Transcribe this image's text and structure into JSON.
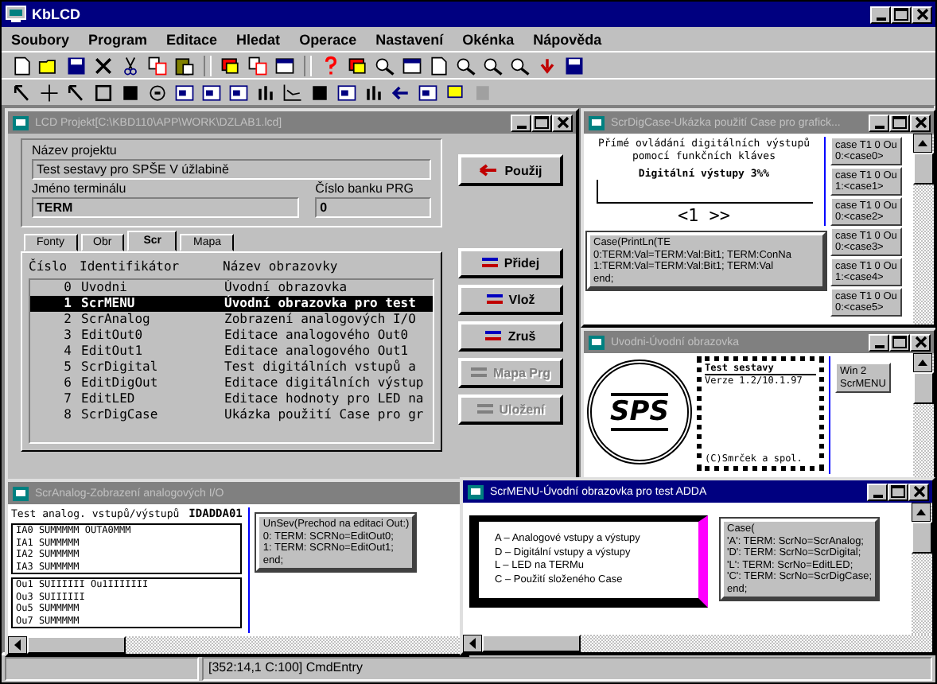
{
  "app": {
    "title": "KbLCD"
  },
  "menu": [
    "Soubory",
    "Program",
    "Editace",
    "Hledat",
    "Operace",
    "Nastavení",
    "Okénka",
    "Nápověda"
  ],
  "project": {
    "title": "LCD Projekt[C:\\KBD110\\APP\\WORK\\DZLAB1.lcd]",
    "active": false,
    "name_label": "Název projektu",
    "name_value": "Test sestavy pro SPŠE V úžlabině",
    "terminal_label": "Jméno terminálu",
    "terminal_value": "TERM",
    "bank_label": "Číslo banku PRG",
    "bank_value": "0",
    "apply_button": "Použij",
    "tabs": [
      {
        "label": "Fonty",
        "selected": false
      },
      {
        "label": "Obr",
        "selected": false
      },
      {
        "label": "Scr",
        "selected": true
      },
      {
        "label": "Mapa",
        "selected": false
      }
    ],
    "columns": [
      "Číslo",
      "Identifikátor",
      "Název obrazovky"
    ],
    "rows": [
      {
        "number": "0",
        "id": "Uvodni",
        "title": "Úvodní obrazovka",
        "selected": false
      },
      {
        "number": "1",
        "id": "ScrMENU",
        "title": "Úvodní obrazovka pro test",
        "selected": true
      },
      {
        "number": "2",
        "id": "ScrAnalog",
        "title": "Zobrazení analogových I/O",
        "selected": false
      },
      {
        "number": "3",
        "id": "EditOut0",
        "title": "Editace analogového Out0",
        "selected": false
      },
      {
        "number": "4",
        "id": "EditOut1",
        "title": "Editace analogového Out1",
        "selected": false
      },
      {
        "number": "5",
        "id": "ScrDigital",
        "title": "Test digitálních vstupů a",
        "selected": false
      },
      {
        "number": "6",
        "id": "EditDigOut",
        "title": "Editace digitálních výstup",
        "selected": false
      },
      {
        "number": "7",
        "id": "EditLED",
        "title": "Editace hodnoty pro LED na",
        "selected": false
      },
      {
        "number": "8",
        "id": "ScrDigCase",
        "title": "Ukázka použití Case pro gr",
        "selected": false
      }
    ],
    "buttons": [
      {
        "label": "Přidej",
        "disabled": false
      },
      {
        "label": "Vlož",
        "disabled": false
      },
      {
        "label": "Zruš",
        "disabled": false
      },
      {
        "label": "Mapa Prg",
        "disabled": true
      },
      {
        "label": "Uložení",
        "disabled": true
      }
    ]
  },
  "digcase": {
    "title": "ScrDigCase-Ukázka použití Case pro grafick...",
    "active": false,
    "lines": [
      "Přímé ovládání digitálních výstupů",
      "pomocí funkčních kláves"
    ],
    "heading": "Digitální výstupy 3%%",
    "nav": "<1 >>",
    "code": [
      "Case(PrintLn(TE",
      "0:TERM:Val=TERM:Val:Bit1; TERM:ConNa",
      "1:TERM:Val=TERM:Val:Bit1; TERM:Val",
      "end;"
    ],
    "cases": [
      [
        "case T1 0 Ou",
        "0:<case0>"
      ],
      [
        "case T1 0 Ou",
        "1:<case1>"
      ],
      [
        "case T1 0 Ou",
        "0:<case2>"
      ],
      [
        "case T1 0 Ou",
        "0:<case3>"
      ],
      [
        "case T1 0 Ou",
        "1:<case4>"
      ],
      [
        "case T1 0 Ou",
        "0:<case5>"
      ]
    ]
  },
  "uvodni": {
    "title": "Uvodni-Úvodní obrazovka",
    "active": false,
    "logo_text": "SPS",
    "box_title": "Test sestavy",
    "box_line": "Verze 1.2/10.1.97",
    "box_footer": "(C)Smrček a spol.",
    "button": [
      "Win 2",
      "ScrMENU"
    ]
  },
  "analog": {
    "title": "ScrAnalog-Zobrazení analogových I/O",
    "active": false,
    "header": "Test analog. vstupů/výstupů",
    "header_id": "IDADDA01",
    "inputs": [
      "IA0 SUMMMMM  OUTA0MMM",
      "IA1 SUMMMMM",
      "IA2 SUMMMMM",
      "IA3 SUMMMMM"
    ],
    "outputs": [
      "Ou1 SUIIIIII  Ou1IIIIIII",
      "Ou3 SUIIIIII",
      "Ou5 SUMMMMM",
      "Ou7 SUMMMMM"
    ],
    "code": [
      "UnSev(Prechod na editaci Out:)",
      "  0: TERM: SCRNo=EditOut0;",
      "  1: TERM: SCRNo=EditOut1;",
      "end;"
    ]
  },
  "menuscr": {
    "title": "ScrMENU-Úvodní obrazovka pro test ADDA",
    "active": true,
    "items": [
      "A – Analogové vstupy a výstupy",
      "D – Digitální vstupy a výstupy",
      "L – LED na TERMu",
      "C – Použití složeného Case"
    ],
    "code": [
      "Case(",
      "'A': TERM: ScrNo=ScrAnalog;",
      "'D': TERM: ScrNo=ScrDigital;",
      "'L': TERM: ScrNo=EditLED;",
      "'C': TERM: ScrNo=ScrDigCase;",
      "end;"
    ]
  },
  "status": {
    "position": "[352:14,1 C:100] CmdEntry"
  }
}
